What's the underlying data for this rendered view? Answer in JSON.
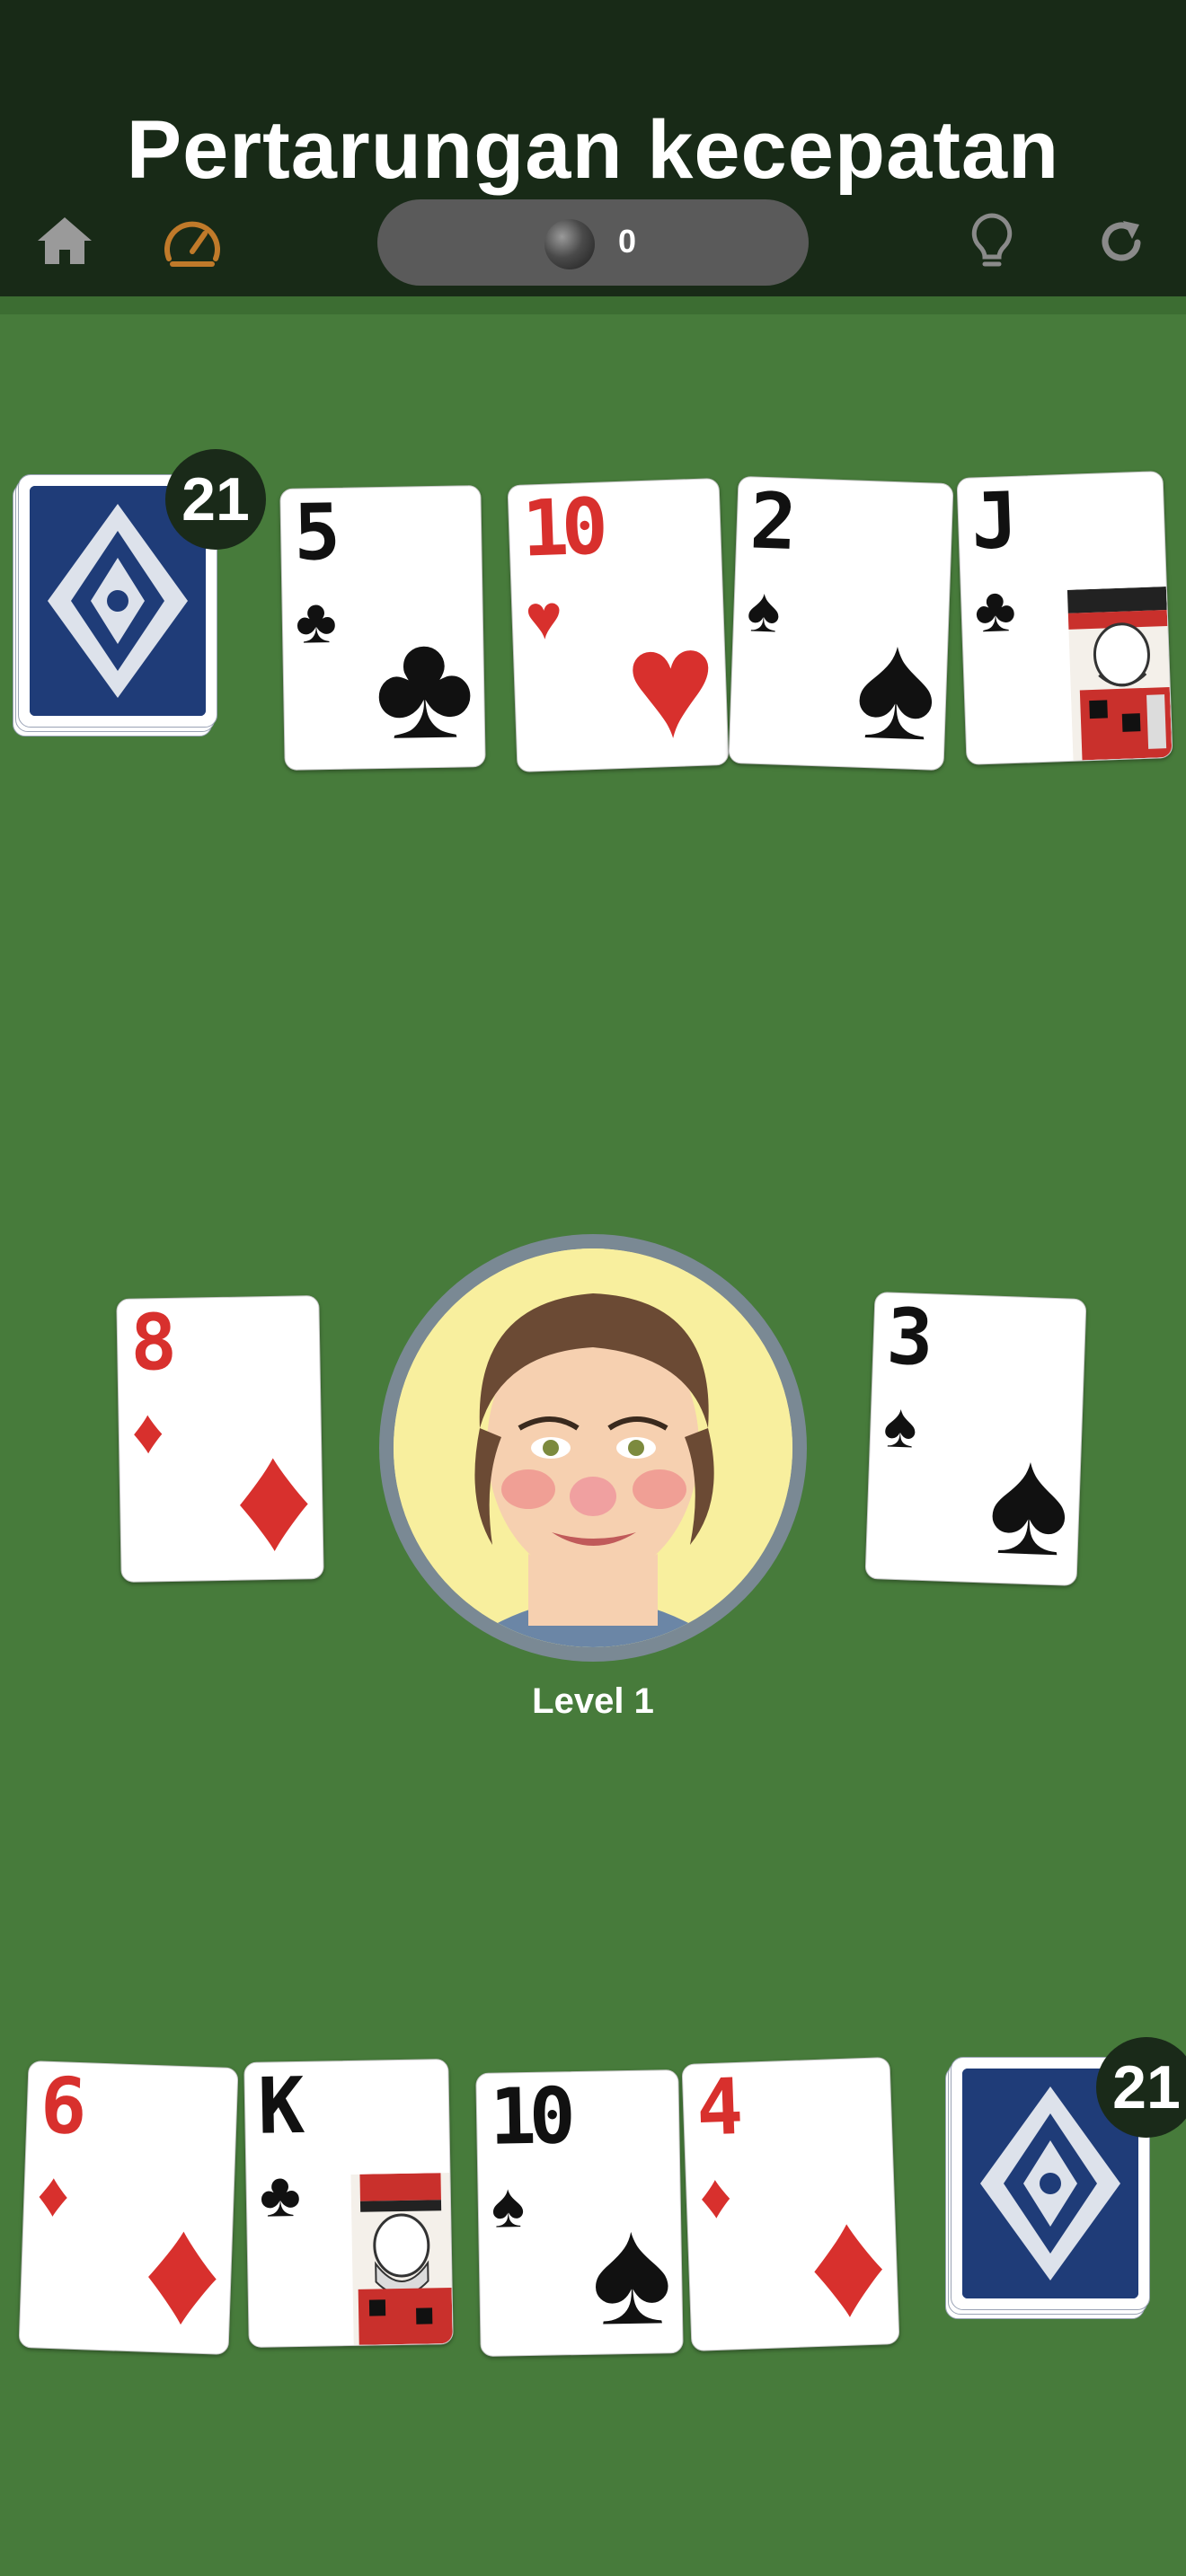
{
  "header": {
    "title": "Pertarungan kecepatan",
    "score": "0",
    "icons": [
      "home-icon",
      "speedometer-icon",
      "lightbulb-icon",
      "restart-icon"
    ]
  },
  "opponent": {
    "deck_count": "21",
    "row": [
      {
        "rank": "5",
        "suit": "♣",
        "color": "black"
      },
      {
        "rank": "10",
        "suit": "♥",
        "color": "red"
      },
      {
        "rank": "2",
        "suit": "♠",
        "color": "black"
      },
      {
        "rank": "J",
        "suit": "♣",
        "color": "black"
      }
    ]
  },
  "center": {
    "left_pile": {
      "rank": "8",
      "suit": "♦",
      "color": "red"
    },
    "right_pile": {
      "rank": "3",
      "suit": "♠",
      "color": "black"
    },
    "level_label": "Level 1"
  },
  "player": {
    "deck_count": "21",
    "hand": [
      {
        "rank": "6",
        "suit": "♦",
        "color": "red"
      },
      {
        "rank": "K",
        "suit": "♣",
        "color": "black"
      },
      {
        "rank": "10",
        "suit": "♠",
        "color": "black"
      },
      {
        "rank": "4",
        "suit": "♦",
        "color": "red"
      }
    ]
  },
  "colors": {
    "felt": "#477b3b",
    "header": "#182a17",
    "red_suit": "#d8302d",
    "black_suit": "#111111",
    "badge": "#1a2a19"
  }
}
